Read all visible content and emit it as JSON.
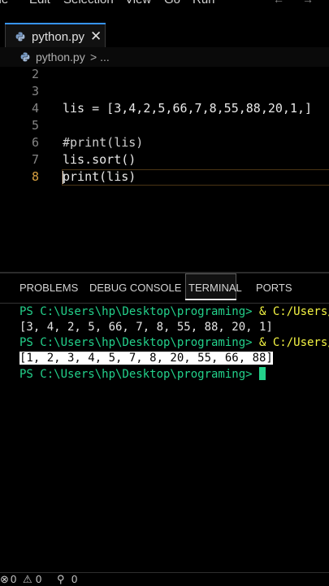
{
  "menu": {
    "items": [
      "File",
      "Edit",
      "Selection",
      "View",
      "Go",
      "Run"
    ]
  },
  "tab": {
    "filename": "python.py",
    "close": "✕"
  },
  "breadcrumb": {
    "file": "python.py",
    "rest": "> ..."
  },
  "editor": {
    "lines": [
      {
        "number": "2",
        "text": ""
      },
      {
        "number": "3",
        "text": ""
      },
      {
        "number": "4",
        "text": "lis = [3,4,2,5,66,7,8,55,88,20,1,]"
      },
      {
        "number": "5",
        "text": ""
      },
      {
        "number": "6",
        "text": "#print(lis)"
      },
      {
        "number": "7",
        "text": "lis.sort()"
      },
      {
        "number": "8",
        "text": "print(lis)"
      }
    ]
  },
  "panel": {
    "tabs": [
      "PROBLEMS",
      "DEBUG CONSOLE",
      "TERMINAL",
      "PORTS"
    ],
    "active_tab": "TERMINAL"
  },
  "terminal": {
    "lines": [
      {
        "prompt": "PS C:\\Users\\hp\\Desktop\\programing>",
        "cmd": " & C:/Users/h"
      },
      {
        "out": "[3, 4, 2, 5, 66, 7, 8, 55, 88, 20, 1]"
      },
      {
        "prompt": "PS C:\\Users\\hp\\Desktop\\programing>",
        "cmd": " & C:/Users/h"
      },
      {
        "out": "[1, 2, 3, 4, 5, 7, 8, 20, 55, 66, 88]"
      },
      {
        "prompt": "PS C:\\Users\\hp\\Desktop\\programing>",
        "cmd": " "
      }
    ]
  },
  "status": {
    "errors": "0",
    "warnings": "0",
    "ports": "0"
  },
  "colors": {
    "prompt": "#23d18b",
    "command": "#f5f543",
    "active_line_number": "#d8a040",
    "tab_accent": "#3794ff"
  }
}
